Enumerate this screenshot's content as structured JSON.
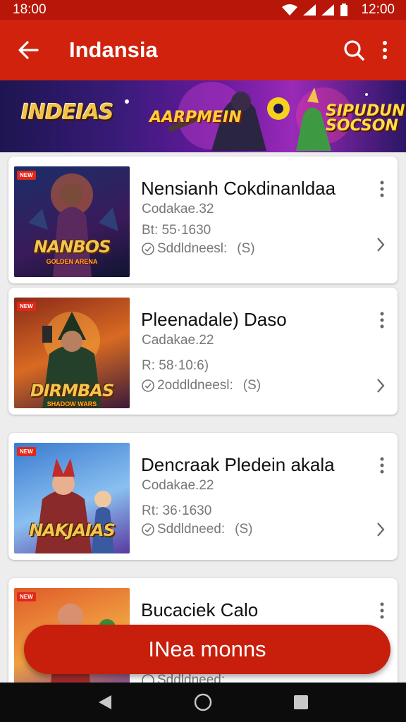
{
  "status_bar": {
    "time": "18:00",
    "clock": "12:00"
  },
  "app_bar": {
    "title": "Indansia",
    "back_icon": "arrow-back-icon",
    "search_icon": "search-icon",
    "menu_icon": "more-vert-icon"
  },
  "banner": {
    "title_left": "INDEIAS",
    "title_center": "AARPMEIN",
    "title_right": "SIPUDUN SOCSON"
  },
  "items": [
    {
      "tag": "NEW",
      "thumb_title": "NANBOS",
      "thumb_sub": "GOLDEN ARENA",
      "title": "Nensianh Cokdinanldaa",
      "meta1": "Codakae.32",
      "meta2": "Bt: 55·1630",
      "meta3": "Sddldneesl:",
      "meta3_suffix": "(S)"
    },
    {
      "tag": "NEW",
      "thumb_title": "DIRMBAS",
      "thumb_sub": "SHADOW WARS",
      "title": "Pleenadale) Daso",
      "meta1": "Cadakae.22",
      "meta2": "R: 58·10:6)",
      "meta3": "2oddldneesl:",
      "meta3_suffix": "(S)"
    },
    {
      "tag": "NEW",
      "thumb_title": "NAKJAIAS",
      "thumb_sub": "",
      "title": "Dencraak Pledein akala",
      "meta1": "Codakae.22",
      "meta2": "Rt: 36·1630",
      "meta3": "Sddldneed:",
      "meta3_suffix": "(S)"
    },
    {
      "tag": "NEW",
      "thumb_title": "",
      "thumb_sub": "",
      "title": "Bucaciek Calo",
      "meta1": "",
      "meta2": "",
      "meta3": "Sddldneed:",
      "meta3_suffix": ""
    }
  ],
  "fab": {
    "label": "INea monns"
  },
  "nav": {
    "back": "nav-back-icon",
    "home": "nav-home-icon",
    "recents": "nav-recents-icon"
  },
  "colors": {
    "primary": "#d0220d",
    "status": "#b81608",
    "fab": "#c81e0c"
  }
}
